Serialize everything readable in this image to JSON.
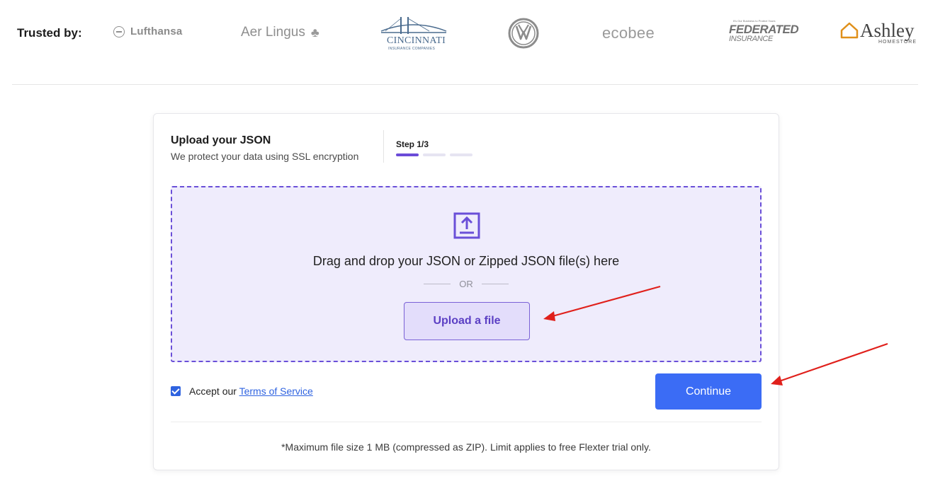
{
  "trusted": {
    "label": "Trusted by:",
    "logos": {
      "lufthansa": "Lufthansa",
      "aer_lingus": "Aer Lingus",
      "cincinnati": "CINCINNATI",
      "cincinnati_sub": "INSURANCE COMPANIES",
      "ecobee": "ecobee",
      "federated_tag": "It's Our Business to Protect Yours",
      "federated": "FEDERATED",
      "federated_sub": "INSURANCE",
      "ashley": "Ashley",
      "ashley_sub": "HOMESTORE"
    }
  },
  "card": {
    "title": "Upload your JSON",
    "subtitle": "We protect your data using SSL encryption",
    "step_label": "Step 1/3",
    "step": {
      "current": 1,
      "total": 3
    },
    "dropzone": {
      "text": "Drag and drop your JSON or Zipped JSON file(s) here",
      "or": "OR",
      "upload_button": "Upload a file"
    },
    "accept_prefix": "Accept our",
    "terms_link": "Terms of Service",
    "accept_checked": true,
    "continue_button": "Continue",
    "footnote": "*Maximum file size 1 MB (compressed as ZIP). Limit applies to free Flexter trial only."
  },
  "colors": {
    "accent": "#6b4bd8",
    "primary_button": "#3b6cf5",
    "dropzone_bg": "#efecfc",
    "annotation_arrow": "#e0201b"
  }
}
